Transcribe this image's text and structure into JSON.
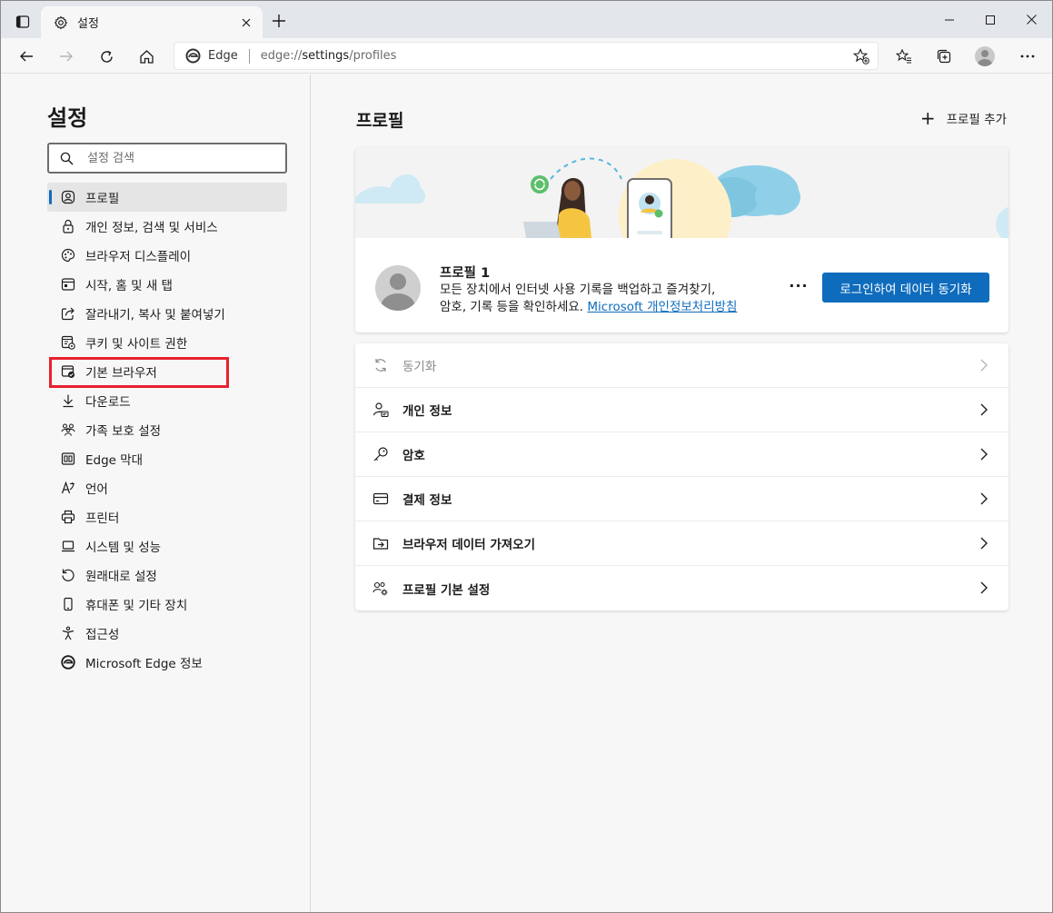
{
  "browser": {
    "tab_title": "설정",
    "site_chip": "Edge",
    "url_prefix": "edge://",
    "url_host": "settings",
    "url_path": "/profiles"
  },
  "sidebar": {
    "title": "설정",
    "search_placeholder": "설정 검색",
    "items": [
      {
        "label": "프로필",
        "icon": "profile-icon"
      },
      {
        "label": "개인 정보, 검색 및 서비스",
        "icon": "lock-icon"
      },
      {
        "label": "브라우저 디스플레이",
        "icon": "palette-icon"
      },
      {
        "label": "시작, 홈 및 새 탭",
        "icon": "home-window-icon"
      },
      {
        "label": "잘라내기, 복사 및 붙여넣기",
        "icon": "share-icon"
      },
      {
        "label": "쿠키 및 사이트 권한",
        "icon": "cookie-icon"
      },
      {
        "label": "기본 브라우저",
        "icon": "default-browser-icon"
      },
      {
        "label": "다운로드",
        "icon": "download-icon"
      },
      {
        "label": "가족 보호 설정",
        "icon": "family-icon"
      },
      {
        "label": "Edge 막대",
        "icon": "edge-bar-icon"
      },
      {
        "label": "언어",
        "icon": "language-icon"
      },
      {
        "label": "프린터",
        "icon": "printer-icon"
      },
      {
        "label": "시스템 및 성능",
        "icon": "laptop-icon"
      },
      {
        "label": "원래대로 설정",
        "icon": "reset-icon"
      },
      {
        "label": "휴대폰 및 기타 장치",
        "icon": "phone-icon"
      },
      {
        "label": "접근성",
        "icon": "accessibility-icon"
      },
      {
        "label": "Microsoft Edge 정보",
        "icon": "edge-logo-icon"
      }
    ]
  },
  "main": {
    "title": "프로필",
    "add_profile": "프로필 추가",
    "profile": {
      "name": "프로필 1",
      "desc_line1": "모든 장치에서 인터넷 사용 기록을 백업하고 즐겨찾기,",
      "desc_line2": "암호, 기록 등을 확인하세요.",
      "link": "Microsoft 개인정보처리방침",
      "more": "···",
      "signin_button": "로그인하여 데이터 동기화"
    },
    "settings": [
      {
        "label": "동기화",
        "icon": "sync-icon",
        "disabled": true
      },
      {
        "label": "개인 정보",
        "icon": "personal-info-icon"
      },
      {
        "label": "암호",
        "icon": "key-icon"
      },
      {
        "label": "결제 정보",
        "icon": "card-icon"
      },
      {
        "label": "브라우저 데이터 가져오기",
        "icon": "import-icon"
      },
      {
        "label": "프로필 기본 설정",
        "icon": "profile-settings-icon"
      }
    ]
  },
  "colors": {
    "accent": "#0f6cbd",
    "highlight_box": "#e8212e"
  }
}
